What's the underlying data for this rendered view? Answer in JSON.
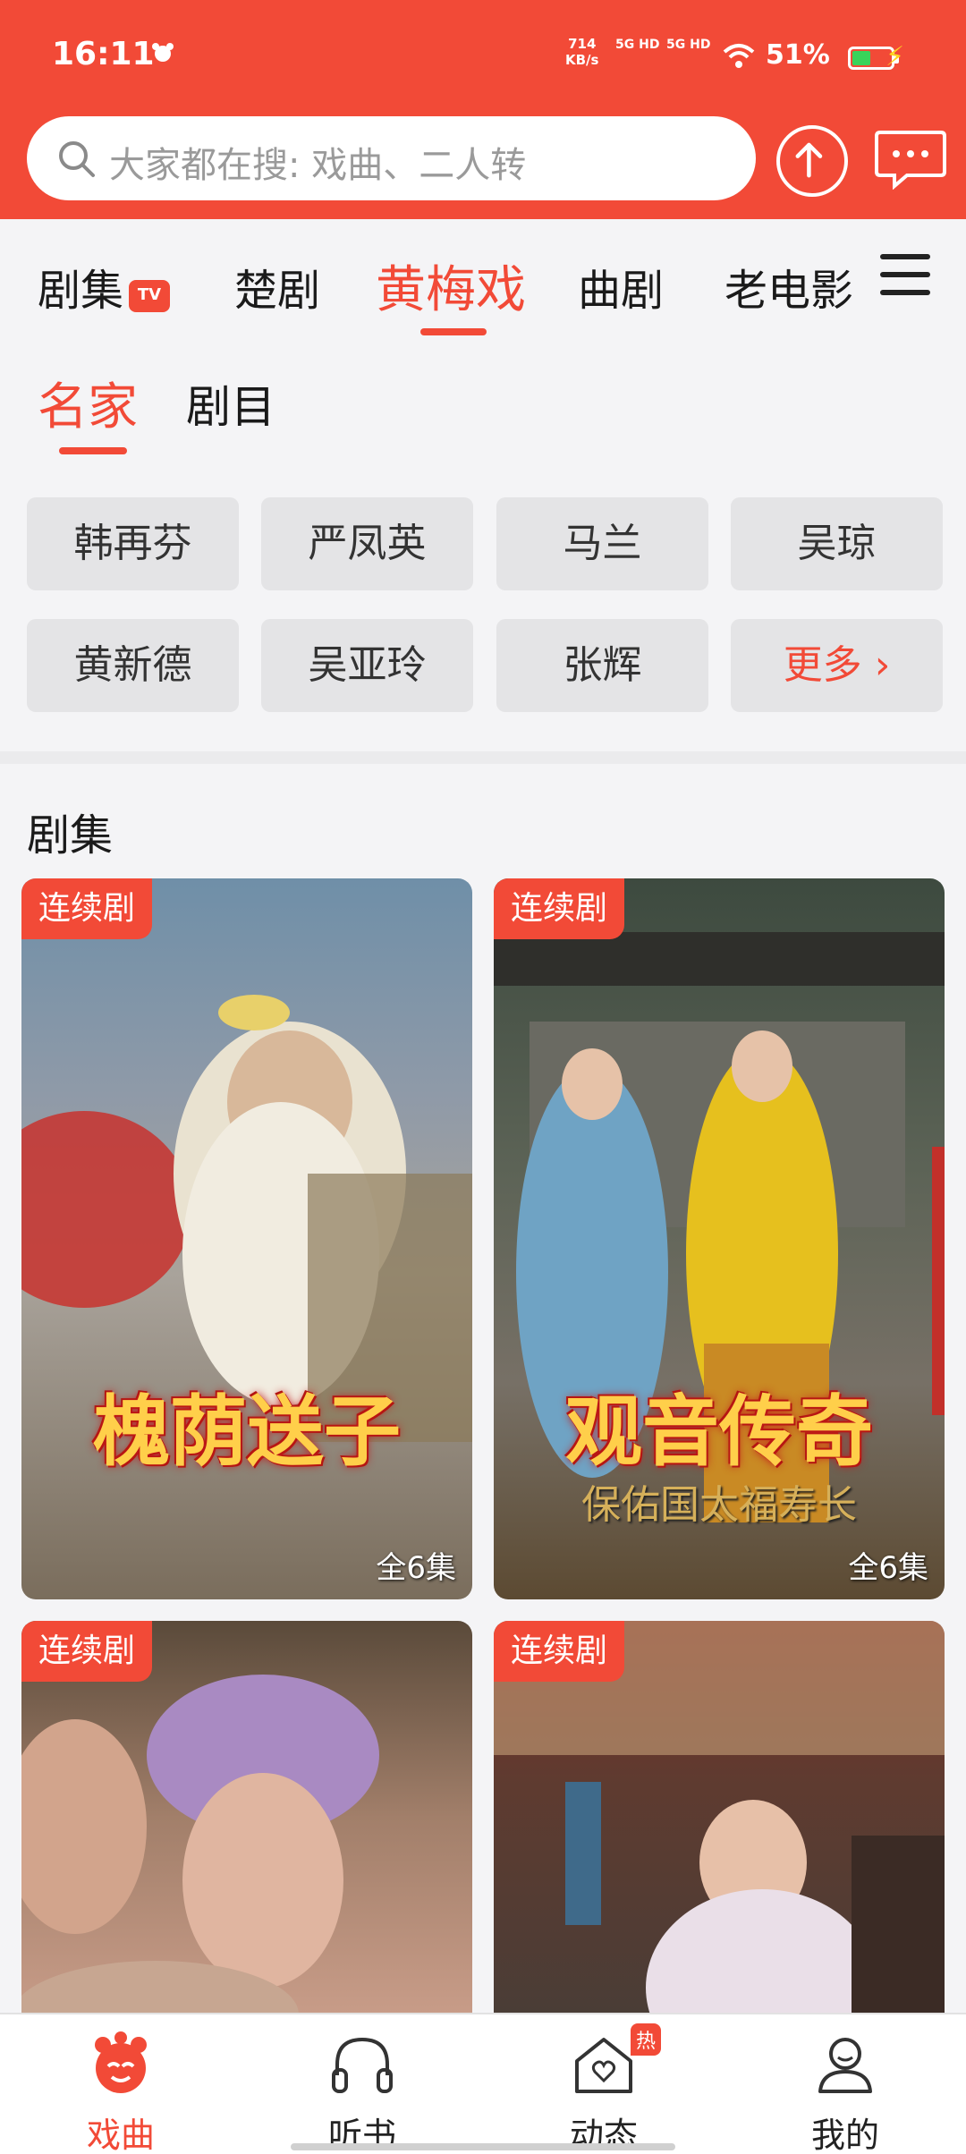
{
  "status_bar": {
    "time": "16:11",
    "net_speed_value": "714",
    "net_speed_unit": "KB/s",
    "signal1": "5G HD",
    "signal2": "5G HD",
    "battery_percent": "51%",
    "battery_level": 0.51
  },
  "search": {
    "placeholder": "大家都在搜: 戏曲、二人转"
  },
  "categories": [
    {
      "label": "剧集",
      "badge": "TV"
    },
    {
      "label": "楚剧"
    },
    {
      "label": "黄梅戏",
      "active": true
    },
    {
      "label": "曲剧"
    },
    {
      "label": "老电影"
    }
  ],
  "subtabs": [
    "名家",
    "剧目"
  ],
  "artists": [
    "韩再芬",
    "严凤英",
    "马兰",
    "吴琼",
    "黄新德",
    "吴亚玲",
    "张辉",
    "更多"
  ],
  "section_title": "剧集",
  "cards": [
    {
      "badge": "连续剧",
      "title": "槐荫送子",
      "subtitle": "",
      "episodes": "全6集"
    },
    {
      "badge": "连续剧",
      "title": "观音传奇",
      "subtitle": "保佑国太福寿长",
      "episodes": "全6集"
    },
    {
      "badge": "连续剧",
      "title": "",
      "subtitle": "",
      "episodes": ""
    },
    {
      "badge": "连续剧",
      "title": "",
      "subtitle": "",
      "episodes": ""
    }
  ],
  "bottom_nav": [
    {
      "label": "戏曲",
      "icon": "opera-mascot-icon",
      "active": true
    },
    {
      "label": "听书",
      "icon": "headphones-icon"
    },
    {
      "label": "动态",
      "icon": "home-heart-icon",
      "badge": "热"
    },
    {
      "label": "我的",
      "icon": "user-icon"
    }
  ],
  "colors": {
    "primary": "#f24a37",
    "chip_bg": "#e4e4e6"
  }
}
